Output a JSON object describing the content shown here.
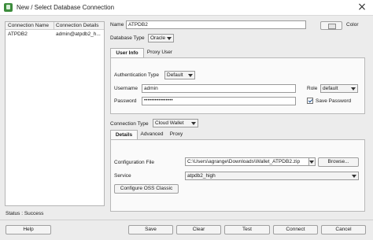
{
  "window": {
    "title": "New / Select Database Connection",
    "close_glyph": "×"
  },
  "connection_list": {
    "columns": [
      "Connection Name",
      "Connection Details"
    ],
    "rows": [
      {
        "name": "ATPDB2",
        "details": "admin@atpdb2_h..."
      }
    ]
  },
  "status": "Status : Success",
  "form": {
    "name_label": "Name",
    "name_value": "ATPDB2",
    "color_label": "Color",
    "db_type_label": "Database Type",
    "db_type_value": "Oracle",
    "tabs": [
      "User Info",
      "Proxy User"
    ],
    "auth_type_label": "Authentication Type",
    "auth_type_value": "Default",
    "username_label": "Username",
    "username_value": "admin",
    "role_label": "Role",
    "role_value": "default",
    "password_label": "Password",
    "password_value": "••••••••••••••••",
    "save_password_label": "Save Password",
    "save_password_checked": true,
    "conn_type_label": "Connection Type",
    "conn_type_value": "Cloud Wallet",
    "detail_tabs": [
      "Details",
      "Advanced",
      "Proxy"
    ],
    "config_file_label": "Configuration File",
    "config_file_value": "C:\\Users\\agrange\\Downloads\\Wallet_ATPDB2.zip",
    "browse_label": "Browse...",
    "service_label": "Service",
    "service_value": "atpdb2_high",
    "configure_oss_label": "Configure OSS Classic"
  },
  "buttons": {
    "help": "Help",
    "save": "Save",
    "clear": "Clear",
    "test": "Test",
    "connect": "Connect",
    "cancel": "Cancel"
  },
  "colors": {
    "window_bg": "#ececec",
    "focus_border": "#7a9cc6"
  }
}
